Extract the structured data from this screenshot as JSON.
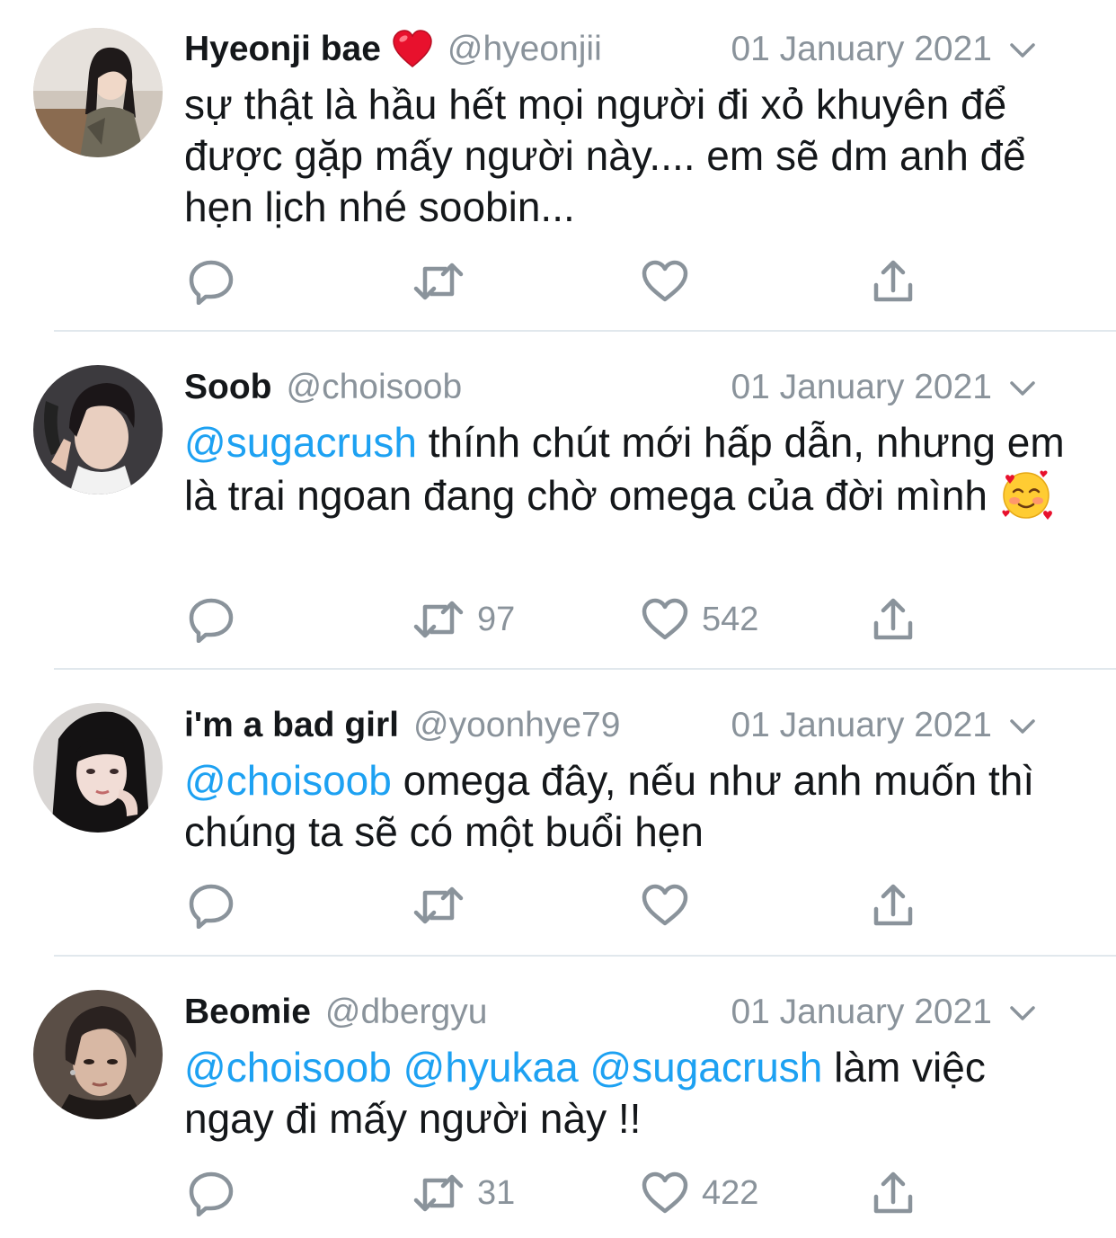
{
  "colors": {
    "text": "#14171a",
    "secondary": "#8a939b",
    "mention": "#1da1f2",
    "divider": "#e1e8ed",
    "like_heart": "#e0245e"
  },
  "tweets": [
    {
      "name": "Hyeonji bae",
      "name_emoji": "red-heart-emoji",
      "handle": "@hyeonjii",
      "date": "01 January 2021",
      "text_parts": [
        {
          "type": "text",
          "value": "sự thật là hầu hết mọi người đi xỏ khuyên để được gặp mấy người này.... em sẽ dm anh để hẹn lịch nhé soobin..."
        }
      ],
      "retweets": "",
      "likes": ""
    },
    {
      "name": "Soob",
      "handle": "@choisoob",
      "date": "01 January 2021",
      "text_parts": [
        {
          "type": "mention",
          "value": "@sugacrush"
        },
        {
          "type": "text",
          "value": " thính chút mới hấp dẫn, nhưng em là trai ngoan đang chờ omega của đời mình "
        }
      ],
      "text_emoji": "smiling-face-with-hearts-emoji",
      "retweets": "97",
      "likes": "542"
    },
    {
      "name": "i'm a bad girl",
      "handle": "@yoonhye79",
      "date": "01 January 2021",
      "text_parts": [
        {
          "type": "mention",
          "value": "@choisoob"
        },
        {
          "type": "text",
          "value": " omega đây, nếu như anh muốn thì chúng ta sẽ có một buổi hẹn"
        }
      ],
      "retweets": "",
      "likes": ""
    },
    {
      "name": "Beomie",
      "handle": "@dbergyu",
      "date": "01 January 2021",
      "text_parts": [
        {
          "type": "mention",
          "value": "@choisoob"
        },
        {
          "type": "text",
          "value": " "
        },
        {
          "type": "mention",
          "value": "@hyukaa"
        },
        {
          "type": "text",
          "value": " "
        },
        {
          "type": "mention",
          "value": "@sugacrush"
        },
        {
          "type": "text",
          "value": " làm việc ngay đi mấy người này !!"
        }
      ],
      "retweets": "31",
      "likes": "422"
    }
  ],
  "icons": {
    "reply": "reply-icon",
    "retweet": "retweet-icon",
    "like": "heart-icon",
    "share": "share-icon",
    "caret": "chevron-down-icon"
  }
}
